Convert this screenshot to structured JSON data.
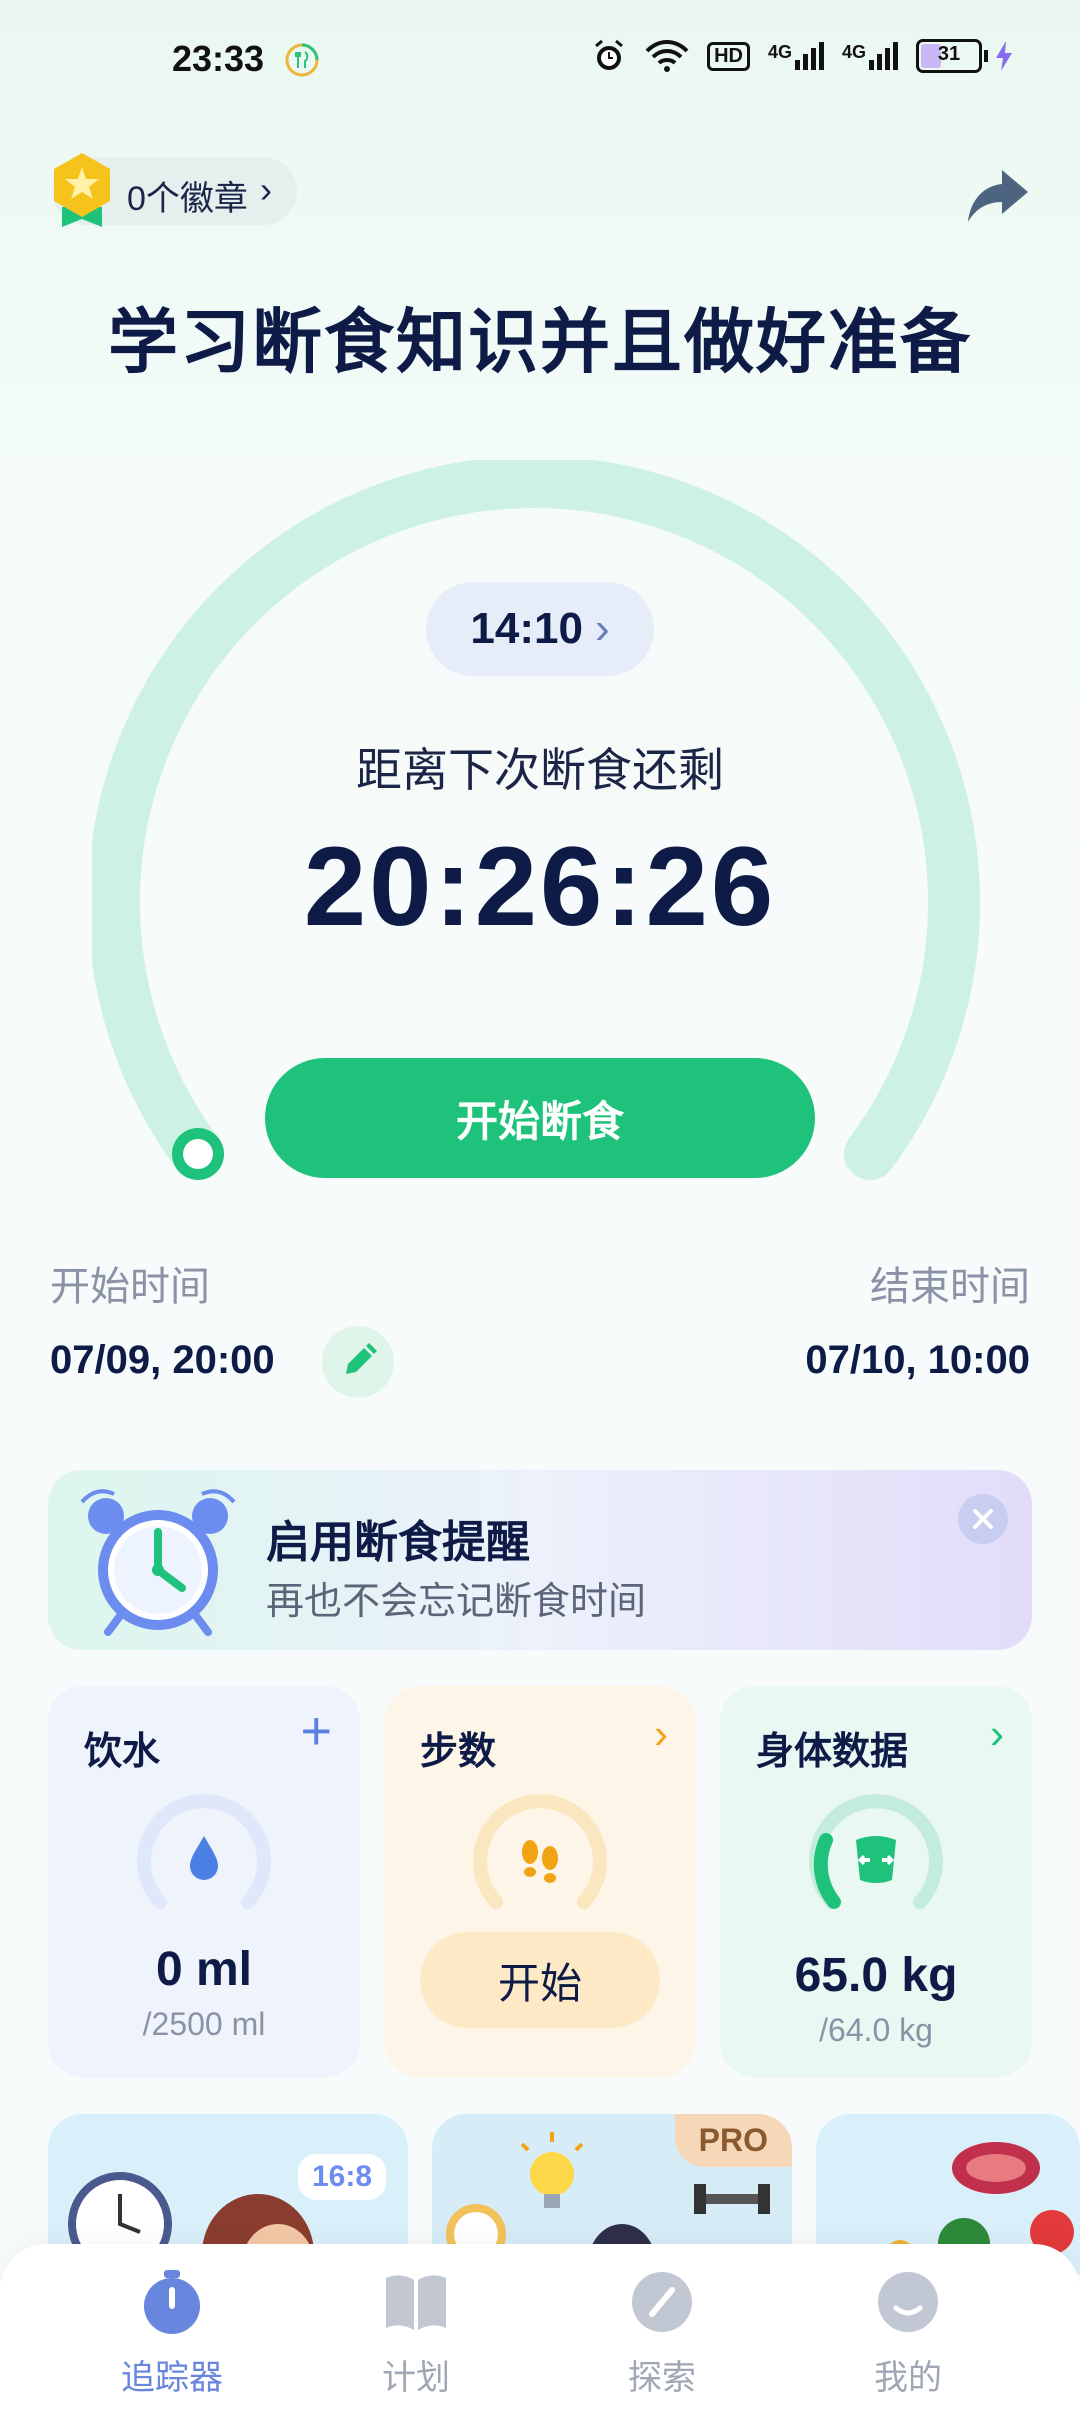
{
  "status_bar": {
    "time": "23:33",
    "hd": "HD",
    "net1": "4G",
    "net2": "4G",
    "battery": "31"
  },
  "header": {
    "badge_label": "0个徽章",
    "badge_chevron": "›",
    "share_icon": "share-icon"
  },
  "title": "学习断食知识并且做好准备",
  "timer": {
    "plan": "14:10",
    "plan_chevron": "›",
    "label": "距离下次断食还剩",
    "countdown": "20:26:26",
    "start_button": "开始断食"
  },
  "schedule": {
    "start_label": "开始时间",
    "start_value": "07/09, 20:00",
    "end_label": "结束时间",
    "end_value": "07/10, 10:00"
  },
  "reminder": {
    "title": "启用断食提醒",
    "subtitle": "再也不会忘记断食时间"
  },
  "cards": {
    "water": {
      "title": "饮水",
      "action": "+",
      "value": "0 ml",
      "sub": "/2500 ml"
    },
    "steps": {
      "title": "步数",
      "action": "›",
      "button": "开始"
    },
    "body": {
      "title": "身体数据",
      "action": "›",
      "value": "65.0 kg",
      "sub": "/64.0 kg"
    }
  },
  "promos": {
    "tag1": "16:8",
    "tag2": "PRO"
  },
  "tabs": [
    {
      "label": "追踪器",
      "icon": "stopwatch-icon"
    },
    {
      "label": "计划",
      "icon": "book-icon"
    },
    {
      "label": "探索",
      "icon": "compass-icon"
    },
    {
      "label": "我的",
      "icon": "profile-icon"
    }
  ],
  "colors": {
    "accent": "#1ec27a",
    "ring": "#cdf1e2",
    "navy": "#0d1b46",
    "tab_active": "#6886dd"
  }
}
